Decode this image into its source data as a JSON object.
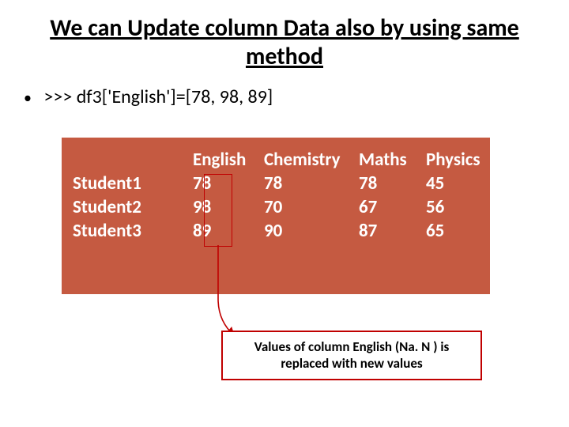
{
  "title": "We can Update column Data also by using same method",
  "code_line": ">>> df3['English']=[78, 98, 89]",
  "table": {
    "columns": [
      "English",
      "Chemistry",
      "Maths",
      "Physics"
    ],
    "rows": [
      {
        "label": "Student1",
        "english": "78",
        "chemistry": "78",
        "maths": "78",
        "physics": "45"
      },
      {
        "label": "Student2",
        "english": "98",
        "chemistry": "70",
        "maths": "67",
        "physics": "56"
      },
      {
        "label": "Student3",
        "english": "89",
        "chemistry": "90",
        "maths": "87",
        "physics": "65"
      }
    ]
  },
  "callout_text": "Values  of column  English (Na. N ) is replaced with new values"
}
